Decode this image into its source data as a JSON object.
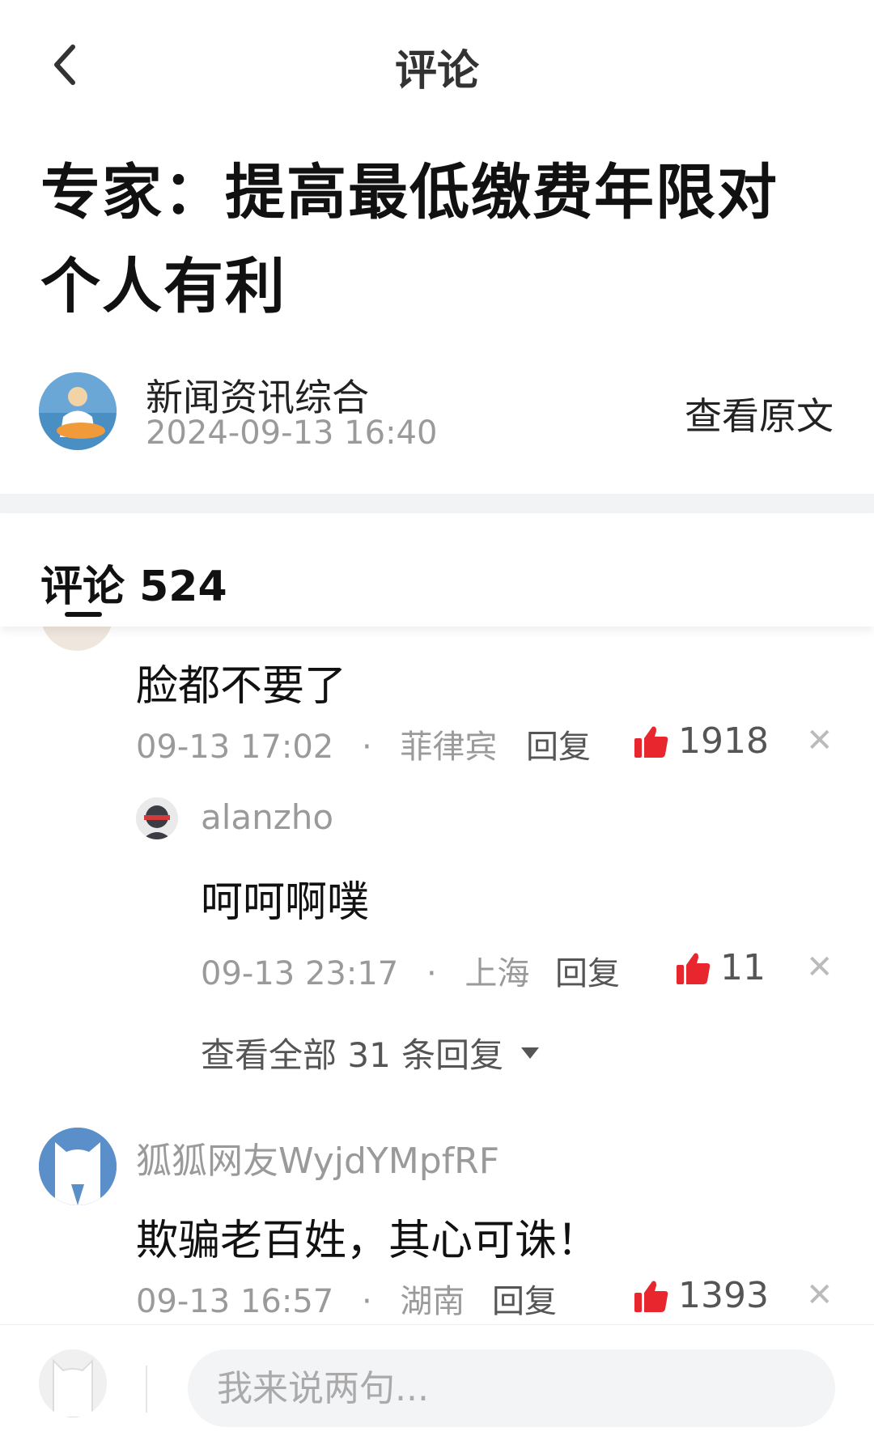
{
  "topbar": {
    "title": "评论"
  },
  "article": {
    "title": "专家：提高最低缴费年限对个人有利",
    "author": "新闻资讯综合",
    "time": "2024-09-13 16:40",
    "view_original": "查看原文"
  },
  "comments_section": {
    "label": "评论",
    "count": "524"
  },
  "comments": [
    {
      "text": "脸都不要了",
      "time": "09-13 17:02",
      "sep": "·",
      "location": "菲律宾",
      "reply_label": "回复",
      "likes": "1918",
      "replies": [
        {
          "user": "alanzho",
          "text": "呵呵啊噗",
          "time": "09-13 23:17",
          "sep": "·",
          "location": "上海",
          "reply_label": "回复",
          "likes": "11"
        }
      ],
      "view_all_replies": "查看全部 31 条回复"
    },
    {
      "user": "狐狐网友WyjdYMpfRF",
      "text": "欺骗老百姓，其心可诛！",
      "time": "09-13 16:57",
      "sep": "·",
      "location": "湖南",
      "reply_label": "回复",
      "likes": "1393"
    }
  ],
  "composer": {
    "placeholder": "我来说两句..."
  },
  "colors": {
    "like": "#e8262d",
    "muted": "#9a9a9a",
    "divider": "#f2f3f5"
  },
  "icons": [
    "back-arrow-icon",
    "thumbs-up-icon",
    "close-icon",
    "dropdown-triangle-icon"
  ]
}
